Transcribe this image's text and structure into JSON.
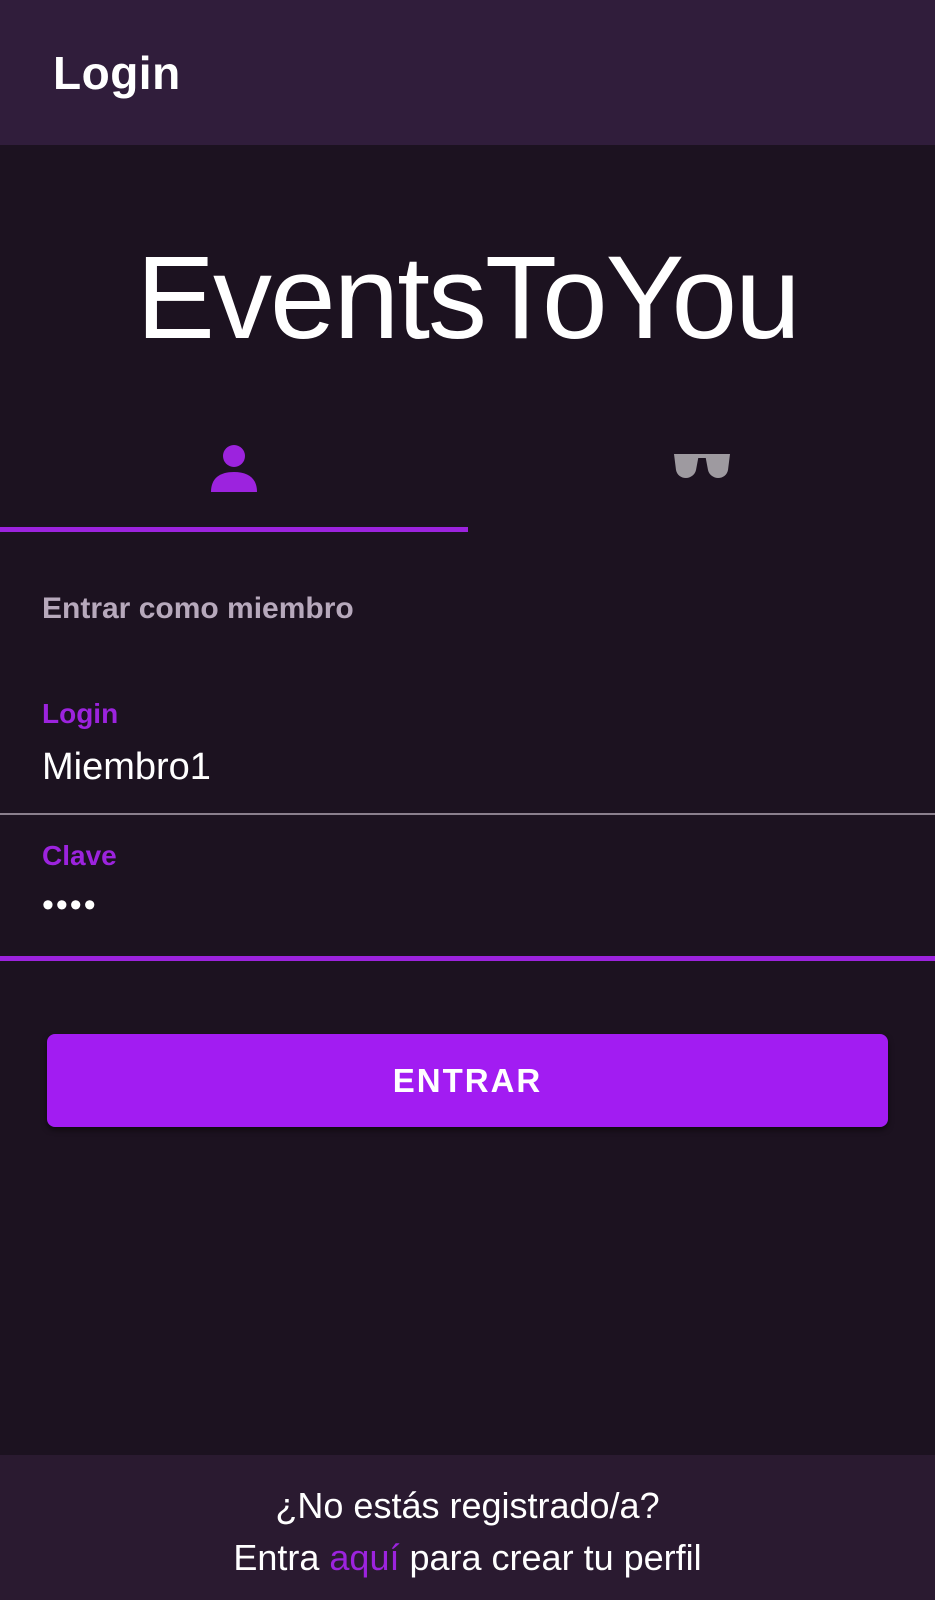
{
  "appbar": {
    "title": "Login"
  },
  "brand": {
    "name": "EventsToYou"
  },
  "tabs": [
    {
      "icon": "person-icon",
      "selected": true,
      "color": "#9c23de"
    },
    {
      "icon": "incognito-glasses-icon",
      "selected": false,
      "color": "#9e9aa0"
    }
  ],
  "form": {
    "section_label": "Entrar como miembro",
    "login_label": "Login",
    "login_value": "Miembro1",
    "password_label": "Clave",
    "password_value": "••••",
    "submit_label": "ENTRAR"
  },
  "footer": {
    "question": "¿No estás registrado/a?",
    "prefix": "Entra ",
    "link": "aquí",
    "suffix": " para crear tu perfil"
  },
  "colors": {
    "accent": "#9c23de",
    "button": "#a21cf2",
    "background": "#1c1220",
    "appbar": "#301d3b"
  }
}
